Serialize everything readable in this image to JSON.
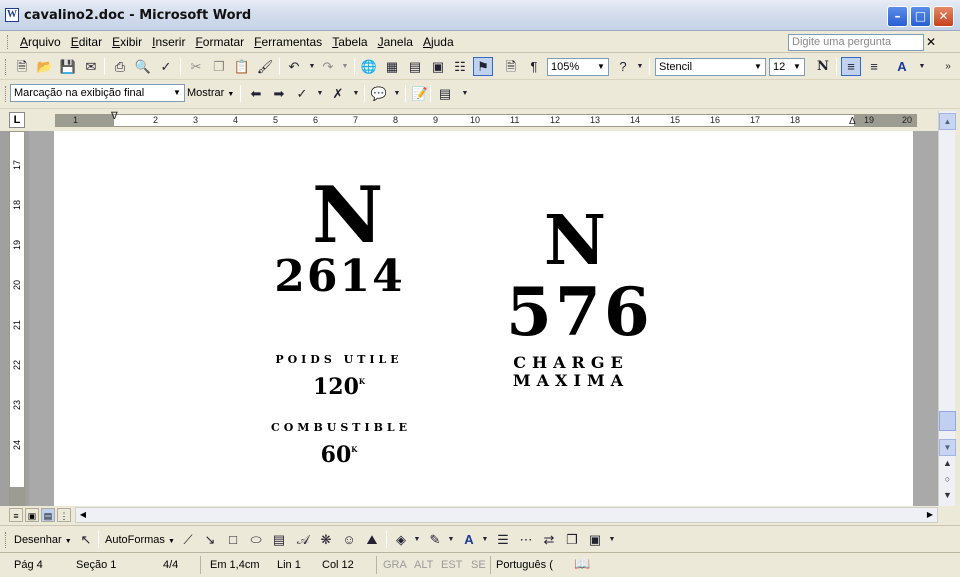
{
  "window": {
    "title": "cavalino2.doc - Microsoft Word"
  },
  "menu": {
    "items": [
      "Arquivo",
      "Editar",
      "Exibir",
      "Inserir",
      "Formatar",
      "Ferramentas",
      "Tabela",
      "Janela",
      "Ajuda"
    ],
    "help_placeholder": "Digite uma pergunta"
  },
  "standard_toolbar": {
    "zoom": "105%",
    "font_name": "Stencil",
    "font_size": "12"
  },
  "review_toolbar": {
    "display_mode": "Marcação na exibição final",
    "show_label": "Mostrar"
  },
  "ruler": {
    "h_numbers": [
      "1",
      "2",
      "3",
      "4",
      "5",
      "6",
      "7",
      "8",
      "9",
      "10",
      "11",
      "12",
      "13",
      "14",
      "15",
      "16",
      "17",
      "18",
      "19",
      "20"
    ],
    "v_numbers": [
      "17",
      "18",
      "19",
      "20",
      "21",
      "22",
      "23",
      "24"
    ]
  },
  "document": {
    "left": {
      "letter": "N",
      "number": "2614",
      "poids_label": "POIDS UTILE",
      "poids_value": "120",
      "poids_unit": "K",
      "combustible_label": "COMBUSTIBLE",
      "combustible_value": "60",
      "combustible_unit": "K"
    },
    "right": {
      "letter": "N",
      "number": "576",
      "charge_label_1": "CHARGE",
      "charge_label_2": "MAXIMA"
    }
  },
  "drawing_toolbar": {
    "draw_label": "Desenhar",
    "autoshapes_label": "AutoFormas"
  },
  "status": {
    "page": "Pág 4",
    "section": "Seção 1",
    "pages": "4/4",
    "at": "Em 1,4cm",
    "line": "Lin 1",
    "col": "Col 12",
    "rec": "GRA",
    "trk": "ALT",
    "ext": "EST",
    "ovr": "SE",
    "language": "Português ("
  }
}
